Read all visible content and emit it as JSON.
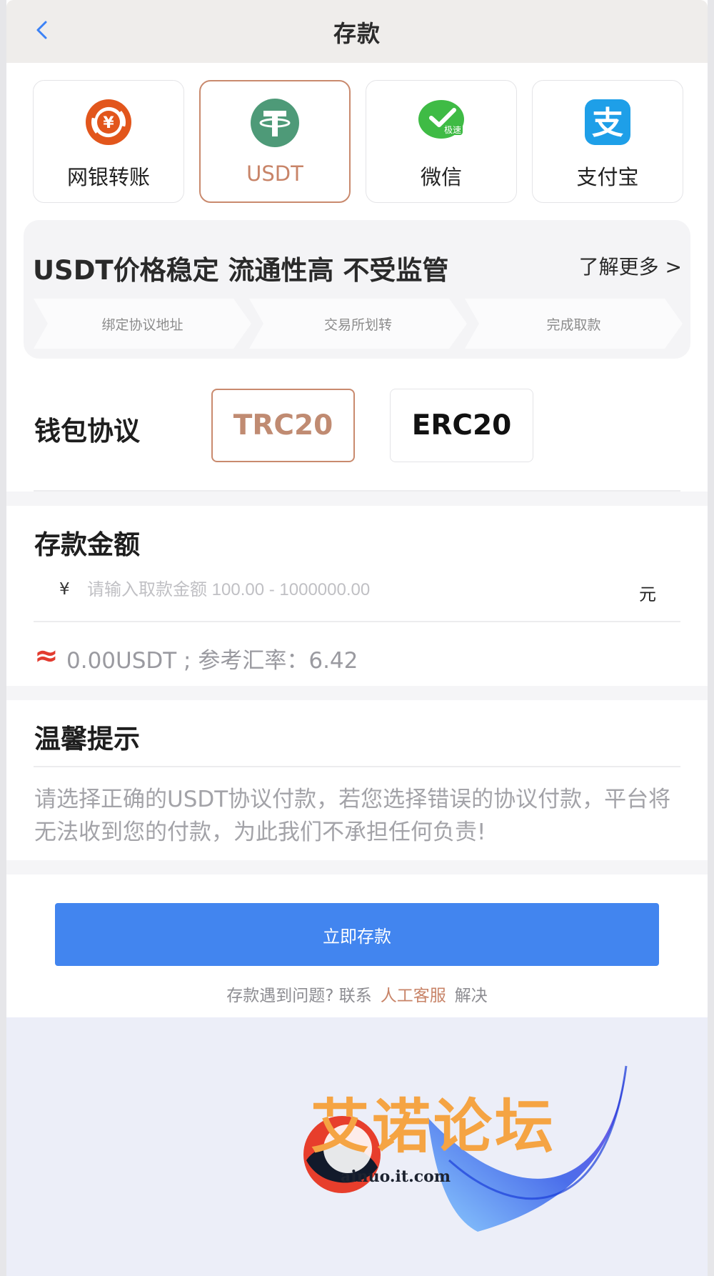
{
  "header": {
    "title": "存款"
  },
  "methods": [
    {
      "label": "网银转账",
      "icon": "yuan-transfer-icon"
    },
    {
      "label": "USDT",
      "icon": "tether-icon",
      "active": true
    },
    {
      "label": "微信",
      "icon": "wechat-express-icon",
      "badge": "极速"
    },
    {
      "label": "支付宝",
      "icon": "alipay-icon",
      "glyph": "支"
    }
  ],
  "promo": {
    "title": "USDT价格稳定 流通性高 不受监管",
    "more": "了解更多 >",
    "steps": [
      "绑定协议地址",
      "交易所划转",
      "完成取款"
    ]
  },
  "protocol": {
    "label": "钱包协议",
    "options": [
      {
        "label": "TRC20",
        "active": true
      },
      {
        "label": "ERC20",
        "active": false
      }
    ]
  },
  "amount": {
    "title": "存款金额",
    "currency_symbol": "¥",
    "placeholder": "请输入取款金额 100.00 - 1000000.00",
    "unit": "元",
    "approx_symbol": "≈",
    "conversion": "0.00USDT ; 参考汇率：6.42"
  },
  "tips": {
    "title": "温馨提示",
    "text": "请选择正确的USDT协议付款，若您选择错误的协议付款，平台将无法收到您的付款，为此我们不承担任何负责!"
  },
  "submit_label": "立即存款",
  "help": {
    "prefix": "存款遇到问题?  联系",
    "link": "人工客服",
    "suffix": "解决"
  },
  "watermark": {
    "name": "艾诺论坛",
    "url": "ainuo.it.com"
  },
  "colors": {
    "accent": "#c98a6e",
    "primary_button": "#4285ef",
    "approx": "#e23b2f",
    "watermark": "#f5a443"
  }
}
